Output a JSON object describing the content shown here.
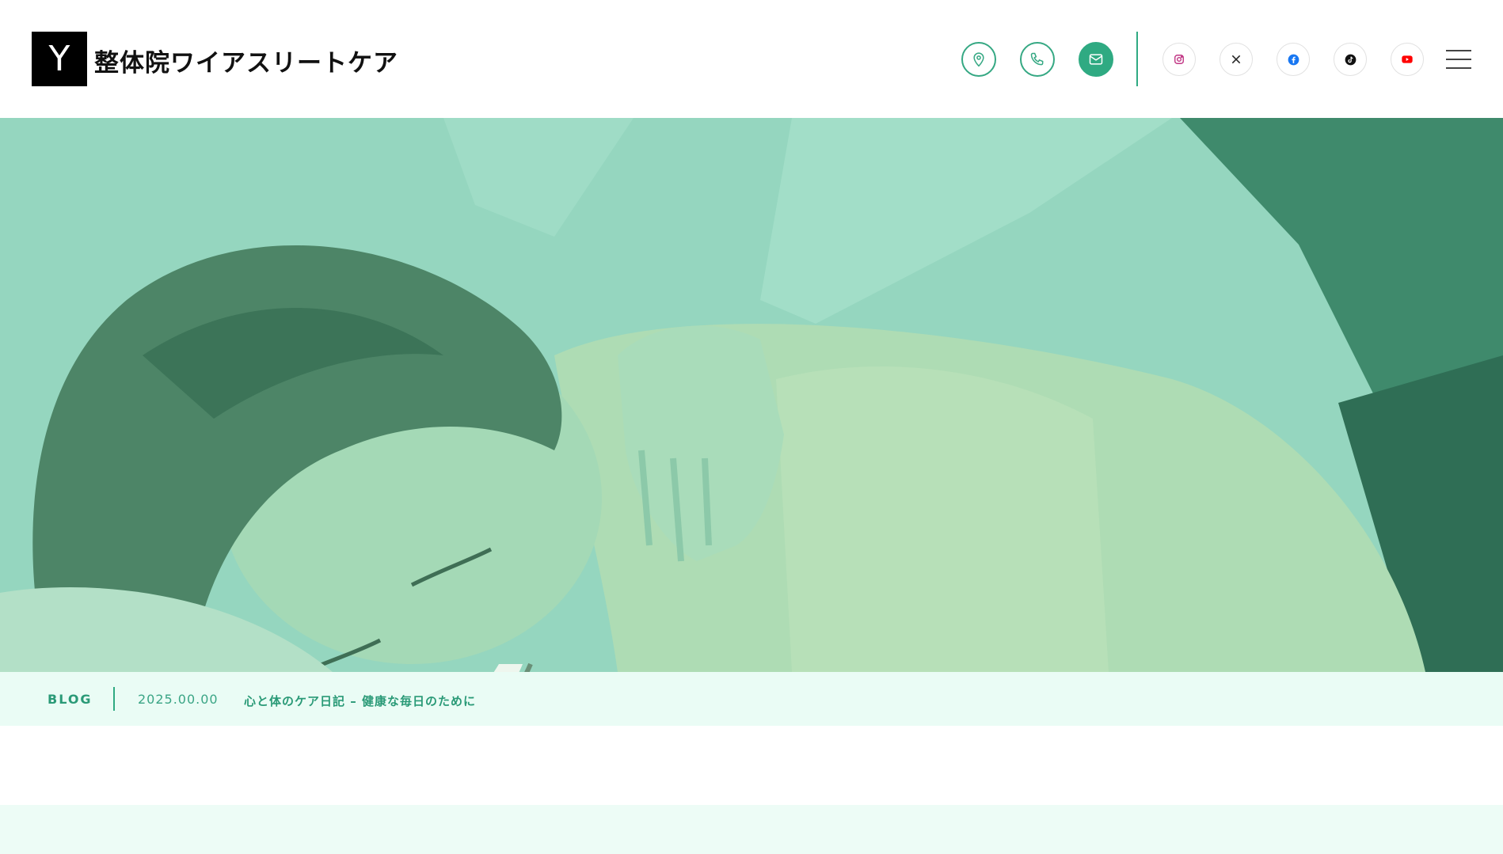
{
  "header": {
    "logo_letter": "Y",
    "site_name": "整体院ワイアスリートケア",
    "contact_icons": [
      "map-pin-icon",
      "phone-icon",
      "mail-icon"
    ],
    "social_icons": [
      "instagram-icon",
      "x-icon",
      "facebook-icon",
      "tiktok-icon",
      "youtube-icon"
    ],
    "menu_icon": "hamburger-menu-icon"
  },
  "breadcrumb": {
    "category": "BLOG",
    "date": "2025.00.00",
    "title": "心と体のケア日記 – 健康な毎日のために"
  },
  "colors": {
    "accent": "#2faa82",
    "hero_overlay": "#93d5be",
    "crumb_bg": "#eafcf5",
    "logo_bg": "#000000"
  },
  "hero": {
    "image": "smiling-woman-receiving-shoulder-massage"
  }
}
